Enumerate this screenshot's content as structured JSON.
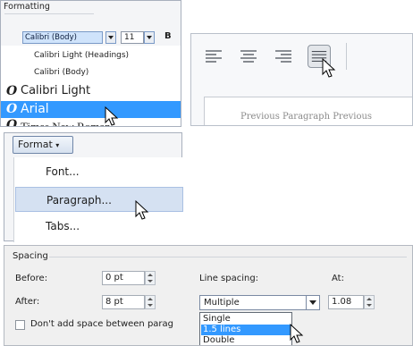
{
  "font_panel": {
    "title": "Formatting",
    "font_name": "Calibri (Body)",
    "font_size": "11",
    "bold_label": "B",
    "font_list": [
      {
        "label": "Calibri Light (Headings)",
        "has_icon": false,
        "selected": false
      },
      {
        "label": "Calibri (Body)",
        "has_icon": false,
        "selected": false
      },
      {
        "label": "Calibri Light",
        "has_icon": true,
        "selected": false
      },
      {
        "label": "Arial",
        "has_icon": true,
        "selected": true
      },
      {
        "label": "Times New Roman",
        "has_icon": true,
        "selected": false
      }
    ],
    "icon_glyph": "O"
  },
  "align_panel": {
    "buttons": [
      {
        "name": "align-left",
        "pressed": false
      },
      {
        "name": "align-center",
        "pressed": false
      },
      {
        "name": "align-right",
        "pressed": false
      },
      {
        "name": "justify",
        "pressed": true
      }
    ],
    "doc_text": "Previous Paragraph Previous"
  },
  "format_panel": {
    "button_label": "Format",
    "button_label_accel": "o",
    "items": [
      {
        "label": "Font...",
        "accel": "F",
        "hover": false
      },
      {
        "label": "Paragraph...",
        "accel": "P",
        "hover": true
      },
      {
        "label": "Tabs...",
        "accel": "T",
        "hover": false
      }
    ]
  },
  "spacing_panel": {
    "title": "Spacing",
    "before_label": "Before:",
    "before_accel": "B",
    "before_value": "0 pt",
    "after_label": "After:",
    "after_accel": "f",
    "after_value": "8 pt",
    "line_spacing_label": "Line spacing:",
    "line_spacing_value": "Multiple",
    "at_label": "At:",
    "at_value": "1.08",
    "checkbox_label": "Don't add space between parag",
    "checkbox_checked": false,
    "options": [
      {
        "label": "Single",
        "selected": false
      },
      {
        "label": "1.5 lines",
        "selected": true
      },
      {
        "label": "Double",
        "selected": false
      }
    ]
  },
  "colors": {
    "selection": "#3399ff",
    "menu_hover": "#d5e1f2"
  }
}
